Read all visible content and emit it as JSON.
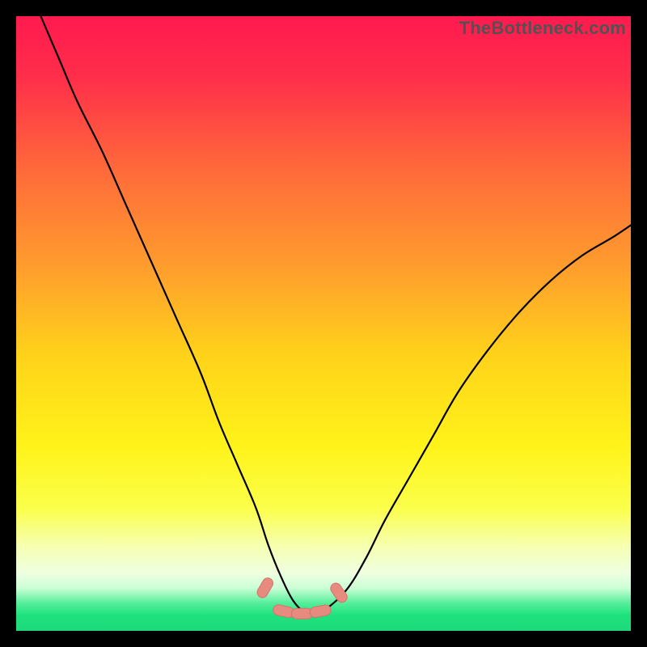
{
  "watermark": "TheBottleneck.com",
  "colors": {
    "black": "#000000",
    "curve": "#000000",
    "marker_fill": "#e78a80",
    "marker_stroke": "#d57468"
  },
  "gradient_stops": [
    {
      "offset": 0.0,
      "color": "#ff1a4f"
    },
    {
      "offset": 0.1,
      "color": "#ff2e4a"
    },
    {
      "offset": 0.25,
      "color": "#ff6a3a"
    },
    {
      "offset": 0.4,
      "color": "#ff9a2e"
    },
    {
      "offset": 0.55,
      "color": "#ffd21a"
    },
    {
      "offset": 0.7,
      "color": "#fff31a"
    },
    {
      "offset": 0.8,
      "color": "#fbff4a"
    },
    {
      "offset": 0.86,
      "color": "#f6ffad"
    },
    {
      "offset": 0.905,
      "color": "#efffe0"
    },
    {
      "offset": 0.93,
      "color": "#ccffd6"
    },
    {
      "offset": 0.955,
      "color": "#55ee9a"
    },
    {
      "offset": 0.975,
      "color": "#1de27d"
    },
    {
      "offset": 1.0,
      "color": "#1fd97a"
    }
  ],
  "chart_data": {
    "type": "line",
    "title": "",
    "xlabel": "",
    "ylabel": "",
    "xlim": [
      0,
      100
    ],
    "ylim": [
      0,
      100
    ],
    "series": [
      {
        "name": "bottleneck-curve",
        "x": [
          4,
          7,
          10,
          14,
          18,
          22,
          26,
          30,
          33,
          36,
          39,
          41,
          43,
          45,
          47,
          49,
          51,
          54,
          57,
          60,
          64,
          68,
          72,
          77,
          82,
          87,
          92,
          97,
          100
        ],
        "y": [
          100,
          93,
          86,
          78,
          69,
          60,
          51,
          42,
          34,
          27,
          20,
          14,
          9,
          5,
          3,
          3,
          4,
          7,
          12,
          18,
          25,
          32,
          39,
          46,
          52,
          57,
          61,
          64,
          66
        ]
      }
    ],
    "markers": {
      "name": "optimal-range",
      "x": [
        40.5,
        43.5,
        46.5,
        49.5,
        52.5
      ],
      "y": [
        7,
        3.2,
        2.8,
        3.2,
        6.2
      ]
    }
  }
}
